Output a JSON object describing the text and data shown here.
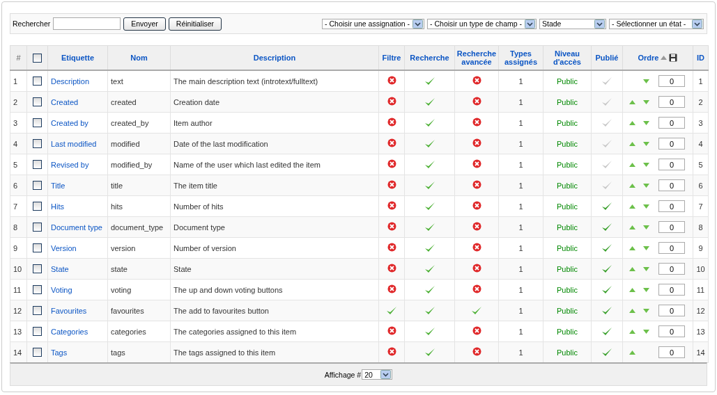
{
  "filter_bar": {
    "search_label": "Rechercher",
    "submit": "Envoyer",
    "reset": "Réinitialiser",
    "selects": [
      "- Choisir une assignation -",
      "- Choisir un type de champ -",
      "Stade",
      "- Sélectionner un état -"
    ]
  },
  "table": {
    "columns": [
      "#",
      "Etiquette",
      "Nom",
      "Description",
      "Filtre",
      "Recherche",
      "Recherche avancée",
      "Types assignés",
      "Niveau d'accès",
      "Publié",
      "Ordre",
      "ID"
    ],
    "select_all_checked": false,
    "rows": [
      {
        "num": "1",
        "checked": false,
        "label": "Description",
        "name": "text",
        "description": "The main description text (introtext/fulltext)",
        "filter": false,
        "search": true,
        "advanced": false,
        "types": "1",
        "access": "Public",
        "published": false,
        "can_up": false,
        "can_down": true,
        "order": "0",
        "id": "1"
      },
      {
        "num": "2",
        "checked": false,
        "label": "Created",
        "name": "created",
        "description": "Creation date",
        "filter": false,
        "search": true,
        "advanced": false,
        "types": "1",
        "access": "Public",
        "published": false,
        "can_up": true,
        "can_down": true,
        "order": "0",
        "id": "2"
      },
      {
        "num": "3",
        "checked": false,
        "label": "Created by",
        "name": "created_by",
        "description": "Item author",
        "filter": false,
        "search": true,
        "advanced": false,
        "types": "1",
        "access": "Public",
        "published": false,
        "can_up": true,
        "can_down": true,
        "order": "0",
        "id": "3"
      },
      {
        "num": "4",
        "checked": false,
        "label": "Last modified",
        "name": "modified",
        "description": "Date of the last modification",
        "filter": false,
        "search": true,
        "advanced": false,
        "types": "1",
        "access": "Public",
        "published": false,
        "can_up": true,
        "can_down": true,
        "order": "0",
        "id": "4"
      },
      {
        "num": "5",
        "checked": false,
        "label": "Revised by",
        "name": "modified_by",
        "description": "Name of the user which last edited the item",
        "filter": false,
        "search": true,
        "advanced": false,
        "types": "1",
        "access": "Public",
        "published": false,
        "can_up": true,
        "can_down": true,
        "order": "0",
        "id": "5"
      },
      {
        "num": "6",
        "checked": false,
        "label": "Title",
        "name": "title",
        "description": "The item title",
        "filter": false,
        "search": true,
        "advanced": false,
        "types": "1",
        "access": "Public",
        "published": false,
        "can_up": true,
        "can_down": true,
        "order": "0",
        "id": "6"
      },
      {
        "num": "7",
        "checked": false,
        "label": "Hits",
        "name": "hits",
        "description": "Number of hits",
        "filter": false,
        "search": true,
        "advanced": false,
        "types": "1",
        "access": "Public",
        "published": true,
        "can_up": true,
        "can_down": true,
        "order": "0",
        "id": "7"
      },
      {
        "num": "8",
        "checked": false,
        "label": "Document type",
        "name": "document_type",
        "description": "Document type",
        "filter": false,
        "search": true,
        "advanced": false,
        "types": "1",
        "access": "Public",
        "published": true,
        "can_up": true,
        "can_down": true,
        "order": "0",
        "id": "8"
      },
      {
        "num": "9",
        "checked": false,
        "label": "Version",
        "name": "version",
        "description": "Number of version",
        "filter": false,
        "search": true,
        "advanced": false,
        "types": "1",
        "access": "Public",
        "published": true,
        "can_up": true,
        "can_down": true,
        "order": "0",
        "id": "9"
      },
      {
        "num": "10",
        "checked": false,
        "label": "State",
        "name": "state",
        "description": "State",
        "filter": false,
        "search": true,
        "advanced": false,
        "types": "1",
        "access": "Public",
        "published": true,
        "can_up": true,
        "can_down": true,
        "order": "0",
        "id": "10"
      },
      {
        "num": "11",
        "checked": false,
        "label": "Voting",
        "name": "voting",
        "description": "The up and down voting buttons",
        "filter": false,
        "search": true,
        "advanced": false,
        "types": "1",
        "access": "Public",
        "published": true,
        "can_up": true,
        "can_down": true,
        "order": "0",
        "id": "11"
      },
      {
        "num": "12",
        "checked": false,
        "label": "Favourites",
        "name": "favourites",
        "description": "The add to favourites button",
        "filter": true,
        "search": true,
        "advanced": true,
        "types": "1",
        "access": "Public",
        "published": true,
        "can_up": true,
        "can_down": true,
        "order": "0",
        "id": "12"
      },
      {
        "num": "13",
        "checked": false,
        "label": "Categories",
        "name": "categories",
        "description": "The categories assigned to this item",
        "filter": false,
        "search": true,
        "advanced": false,
        "types": "1",
        "access": "Public",
        "published": true,
        "can_up": true,
        "can_down": true,
        "order": "0",
        "id": "13"
      },
      {
        "num": "14",
        "checked": false,
        "label": "Tags",
        "name": "tags",
        "description": "The tags assigned to this item",
        "filter": false,
        "search": true,
        "advanced": false,
        "types": "1",
        "access": "Public",
        "published": true,
        "can_up": true,
        "can_down": false,
        "order": "0",
        "id": "14"
      }
    ]
  },
  "footer": {
    "label": "Affichage #",
    "limit": "20"
  }
}
